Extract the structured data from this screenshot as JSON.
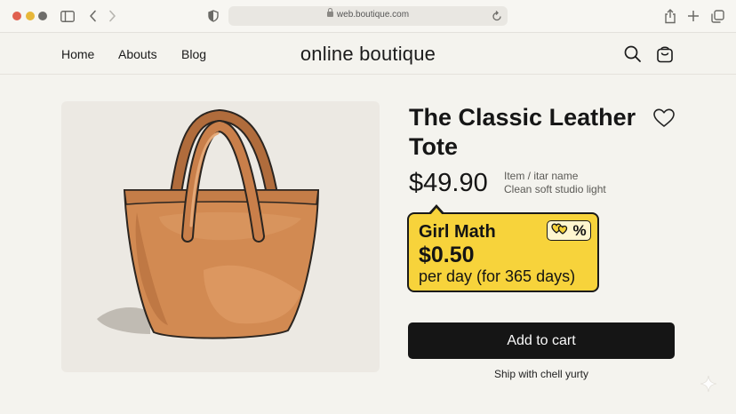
{
  "browser": {
    "url": "web.boutique.com",
    "icons": [
      "sidebar-icon",
      "back-icon",
      "forward-icon",
      "shield-icon",
      "lock-icon",
      "reload-icon",
      "share-icon",
      "plus-icon",
      "tabs-icon"
    ]
  },
  "site": {
    "brand": "online boutique",
    "nav": [
      "Home",
      "Abouts",
      "Blog"
    ],
    "header_icons": [
      "search-icon",
      "cart-icon"
    ]
  },
  "product": {
    "title": "The Classic Leather Tote",
    "price": "$49.90",
    "meta_line1": "Item / itar name",
    "meta_line2": "Clean soft studio light",
    "image_icon": "tote-bag-illustration",
    "bag_color": "#d28a52"
  },
  "promo": {
    "title": "Girl Math",
    "amount": "$0.50",
    "note": "per day (for 365 days)",
    "badge": "%",
    "color": "#f7d33b"
  },
  "actions": {
    "add_to_cart": "Add to cart",
    "ship_note": "Ship with chell yurty"
  }
}
